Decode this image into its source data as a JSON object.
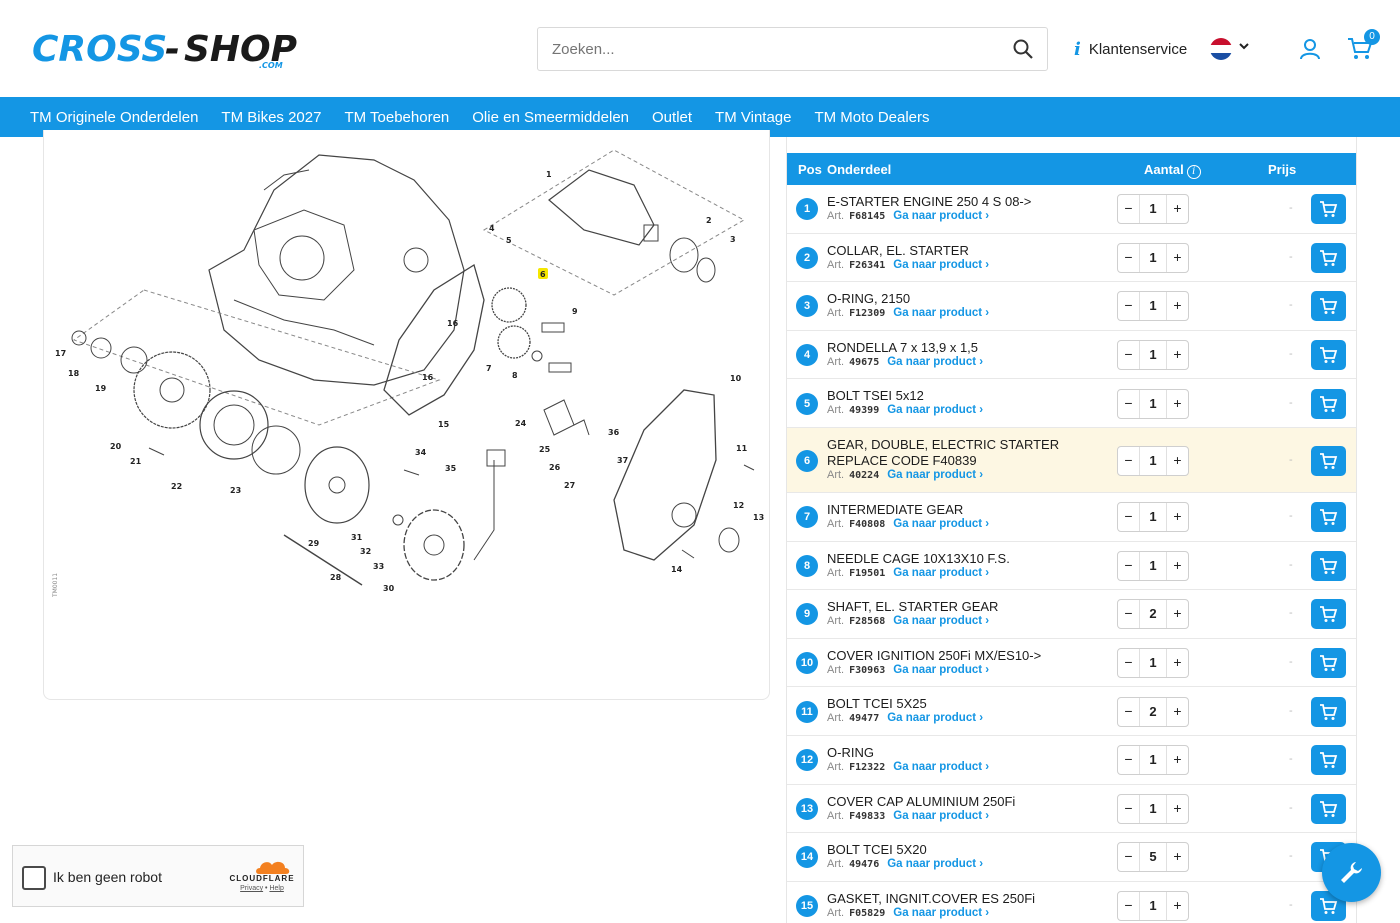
{
  "header": {
    "logo_text": "CROSS-SHOP",
    "logo_sub": ".COM",
    "search_placeholder": "Zoeken...",
    "klantenservice": "Klantenservice",
    "cart_count": "0"
  },
  "nav": [
    "TM Originele Onderdelen",
    "TM Bikes 2027",
    "TM Toebehoren",
    "Olie en Smeermiddelen",
    "Outlet",
    "TM Vintage",
    "TM Moto Dealers"
  ],
  "diagram": {
    "code": "TM0011",
    "labels": [
      "1",
      "2",
      "3",
      "4",
      "5",
      "6",
      "7",
      "8",
      "9",
      "10",
      "11",
      "12",
      "13",
      "14",
      "15",
      "16",
      "16",
      "17",
      "18",
      "19",
      "20",
      "21",
      "22",
      "23",
      "24",
      "25",
      "26",
      "27",
      "28",
      "29",
      "30",
      "31",
      "32",
      "33",
      "34",
      "35",
      "36",
      "37"
    ],
    "highlighted": "6"
  },
  "table": {
    "headers": {
      "pos": "Pos",
      "part": "Onderdeel",
      "qty": "Aantal",
      "price": "Prijs"
    },
    "art_prefix": "Art.",
    "link_label": "Ga naar product ›",
    "rows": [
      {
        "pos": "1",
        "name": "E-STARTER ENGINE 250 4 S 08->",
        "art": "F68145",
        "qty": "1",
        "price": "-"
      },
      {
        "pos": "2",
        "name": "COLLAR, EL. STARTER",
        "art": "F26341",
        "qty": "1",
        "price": "-"
      },
      {
        "pos": "3",
        "name": "O-RING, 2150",
        "art": "F12309",
        "qty": "1",
        "price": "-"
      },
      {
        "pos": "4",
        "name": "RONDELLA 7 x 13,9 x 1,5",
        "art": "49675",
        "qty": "1",
        "price": "-"
      },
      {
        "pos": "5",
        "name": "BOLT TSEI 5x12",
        "art": "49399",
        "qty": "1",
        "price": "-"
      },
      {
        "pos": "6",
        "name": "GEAR, DOUBLE, ELECTRIC STARTER REPLACE CODE F40839",
        "art": "40224",
        "qty": "1",
        "price": "-",
        "highlight": true
      },
      {
        "pos": "7",
        "name": "INTERMEDIATE GEAR",
        "art": "F40808",
        "qty": "1",
        "price": "-"
      },
      {
        "pos": "8",
        "name": "NEEDLE CAGE 10X13X10 F.S.",
        "art": "F19501",
        "qty": "1",
        "price": "-"
      },
      {
        "pos": "9",
        "name": "SHAFT, EL. STARTER GEAR",
        "art": "F28568",
        "qty": "2",
        "price": "-"
      },
      {
        "pos": "10",
        "name": "COVER IGNITION 250Fi MX/ES10->",
        "art": "F30963",
        "qty": "1",
        "price": "-"
      },
      {
        "pos": "11",
        "name": "BOLT TCEI 5X25",
        "art": "49477",
        "qty": "2",
        "price": "-"
      },
      {
        "pos": "12",
        "name": "O-RING",
        "art": "F12322",
        "qty": "1",
        "price": "-"
      },
      {
        "pos": "13",
        "name": "COVER CAP ALUMINIUM 250Fi",
        "art": "F49833",
        "qty": "1",
        "price": "-"
      },
      {
        "pos": "14",
        "name": "BOLT TCEI 5X20",
        "art": "49476",
        "qty": "5",
        "price": "-"
      },
      {
        "pos": "15",
        "name": "GASKET, INGNIT.COVER ES 250Fi",
        "art": "F05829",
        "qty": "1",
        "price": "-"
      }
    ]
  },
  "captcha": {
    "label": "Ik ben geen robot",
    "brand": "CLOUDFLARE",
    "privacy": "Privacy",
    "sep": " • ",
    "help": "Help"
  },
  "colors": {
    "accent": "#1496e4",
    "highlight_row": "#fdf7e3"
  }
}
